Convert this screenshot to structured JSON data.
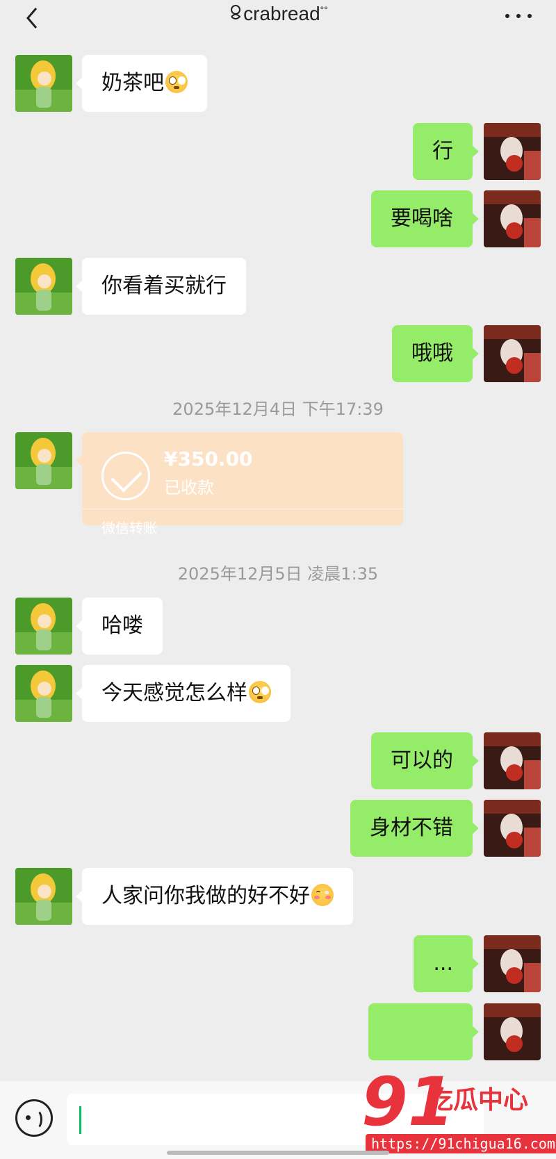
{
  "header": {
    "back_label": "<",
    "title": "crabread",
    "more_label": "···"
  },
  "colors": {
    "background": "#ededed",
    "bubble_self": "#95ec69",
    "bubble_other": "#ffffff",
    "transfer_bg": "#fde1c5",
    "watermark": "#e8333c"
  },
  "messages": [
    {
      "side": "left",
      "text": "奶茶吧",
      "emoji": "flushed-face"
    },
    {
      "side": "right",
      "text": "行"
    },
    {
      "side": "right",
      "text": "要喝啥"
    },
    {
      "side": "left",
      "text": "你看着买就行"
    },
    {
      "side": "right",
      "text": "哦哦"
    },
    {
      "type": "timestamp",
      "text": "2025年12月4日 下午17:39"
    },
    {
      "side": "left",
      "type": "transfer",
      "amount": "¥350.00",
      "status": "已收款",
      "label": "微信转账"
    },
    {
      "type": "timestamp",
      "text": "2025年12月5日 凌晨1:35"
    },
    {
      "side": "left",
      "text": "哈喽"
    },
    {
      "side": "left",
      "text": "今天感觉怎么样",
      "emoji": "flushed-face"
    },
    {
      "side": "right",
      "text": "可以的"
    },
    {
      "side": "right",
      "text": "身材不错"
    },
    {
      "side": "left",
      "text": "人家问你我做的好不好",
      "emoji": "blushing-face"
    },
    {
      "side": "right",
      "text": "..."
    }
  ],
  "input": {
    "placeholder": ""
  },
  "watermark": {
    "number": "91",
    "text": "吃瓜中心",
    "url": "https://91chigua16.com"
  }
}
